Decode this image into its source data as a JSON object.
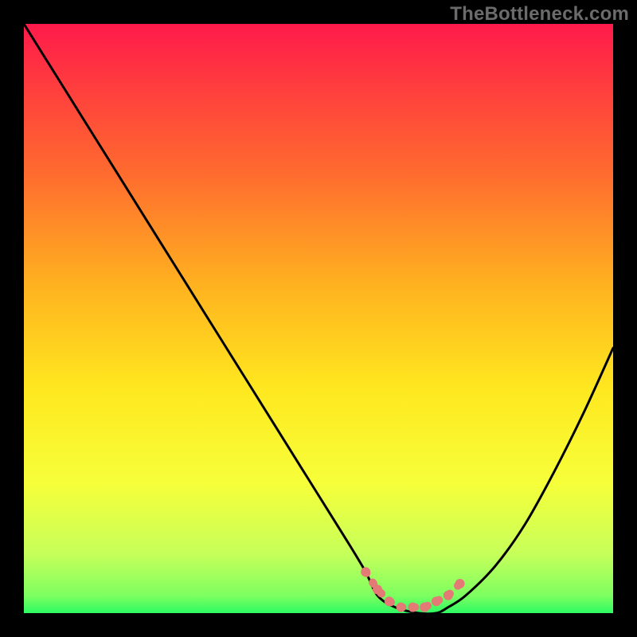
{
  "watermark": "TheBottleneck.com",
  "colors": {
    "black": "#000000",
    "marker": "#e37a76",
    "curve": "#000000",
    "gradient_stops": [
      {
        "offset": 0,
        "color": "#ff1a4b"
      },
      {
        "offset": 0.1,
        "color": "#ff3b3f"
      },
      {
        "offset": 0.25,
        "color": "#ff6a2f"
      },
      {
        "offset": 0.45,
        "color": "#ffb41f"
      },
      {
        "offset": 0.62,
        "color": "#ffe81f"
      },
      {
        "offset": 0.78,
        "color": "#f6ff3a"
      },
      {
        "offset": 0.9,
        "color": "#c6ff5a"
      },
      {
        "offset": 0.97,
        "color": "#7eff60"
      },
      {
        "offset": 1.0,
        "color": "#2dfb63"
      }
    ]
  },
  "chart_data": {
    "type": "line",
    "title": "",
    "xlabel": "",
    "ylabel": "",
    "xlim": [
      0,
      100
    ],
    "ylim": [
      0,
      100
    ],
    "x": [
      0,
      5,
      10,
      15,
      20,
      25,
      30,
      35,
      40,
      45,
      50,
      55,
      58,
      60,
      63,
      67,
      70,
      72,
      75,
      80,
      85,
      90,
      95,
      100
    ],
    "values": [
      100,
      92,
      84,
      76,
      68,
      60,
      52,
      44,
      36,
      28,
      20,
      12,
      7,
      3,
      1,
      0,
      0,
      1,
      3,
      8,
      15,
      24,
      34,
      45
    ],
    "markers_x": [
      58,
      60,
      62,
      64,
      66,
      68,
      70,
      72,
      74
    ],
    "markers_y": [
      7,
      4,
      2,
      1,
      1,
      1,
      2,
      3,
      5
    ]
  }
}
